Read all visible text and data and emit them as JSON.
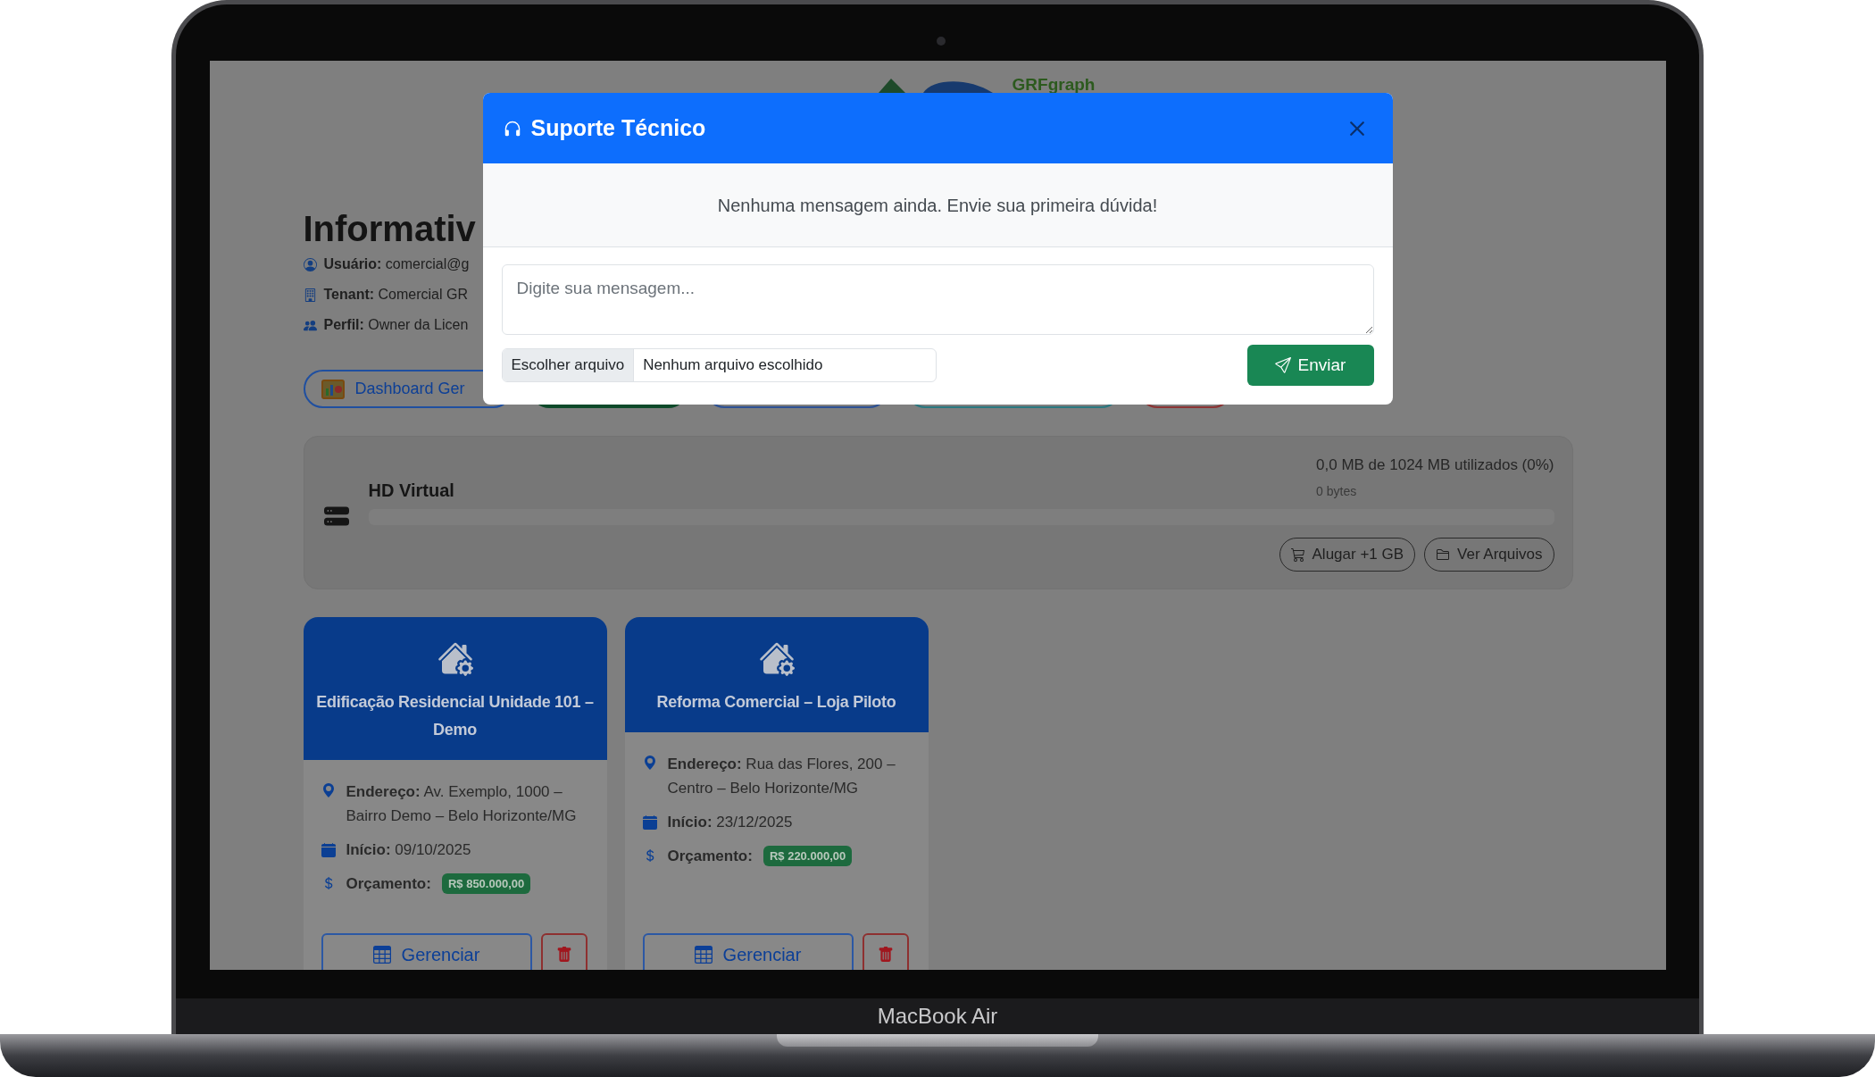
{
  "device_label": "MacBook Air",
  "page": {
    "brand": "GRFgraph",
    "heading": "Informativ",
    "info": [
      {
        "kind": "user",
        "text": "**Usuário:** comercial@g"
      },
      {
        "kind": "tenant",
        "text": "**Tenant:** Comercial GR"
      },
      {
        "kind": "profile",
        "text": "**Perfil:** Owner da Licen"
      }
    ],
    "toolbar": [
      {
        "kind": "dashboard",
        "label": "Dashboard Ger"
      },
      {
        "kind": "success"
      },
      {
        "kind": "primary"
      },
      {
        "kind": "info"
      },
      {
        "kind": "danger"
      }
    ]
  },
  "storage": {
    "title": "HD Virtual",
    "usage": "0,0 MB de 1024 MB utilizados (0%)",
    "bytes": "0 bytes",
    "level": 0,
    "actions": [
      {
        "kind": "rent",
        "label": "Alugar +1 GB"
      },
      {
        "kind": "files",
        "label": "Ver Arquivos"
      }
    ]
  },
  "projects": [
    {
      "title": "Edificação Residencial Unidade 101 – Demo",
      "address": "**Endereço:** Av. Exemplo, 1000 – Bairro Demo – Belo Horizonte/MG",
      "start": "**Início:** 09/10/2025",
      "budget_label": "Orçamento:",
      "budget": "R$ 850.000,00",
      "manage": "Gerenciar"
    },
    {
      "title": "Reforma Comercial – Loja Piloto",
      "address": "**Endereço:** Rua das Flores, 200 – Centro – Belo Horizonte/MG",
      "start": "**Início:** 23/12/2025",
      "budget_label": "Orçamento:",
      "budget": "R$ 220.000,00",
      "manage": "Gerenciar"
    }
  ],
  "modal": {
    "title": "Suporte Técnico",
    "empty_message": "Nenhuma mensagem ainda. Envie sua primeira dúvida!",
    "message_placeholder": "Digite sua mensagem...",
    "file_button": "Escolher arquivo",
    "file_status": "Nenhum arquivo escolhido",
    "send": "Enviar"
  }
}
